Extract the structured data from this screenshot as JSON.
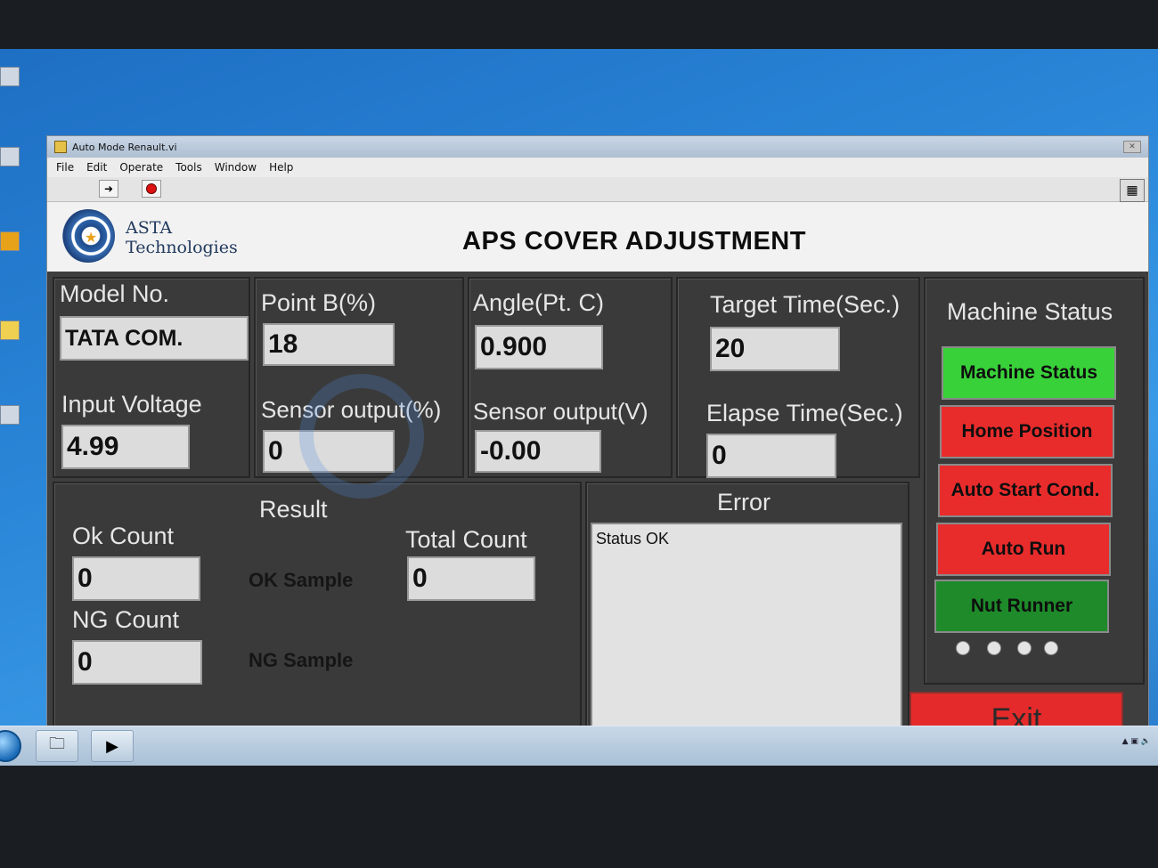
{
  "window": {
    "title": "Auto Mode Renault.vi"
  },
  "menu": [
    "File",
    "Edit",
    "Operate",
    "Tools",
    "Window",
    "Help"
  ],
  "brand": {
    "line1": "ASTA",
    "line2": "Technologies"
  },
  "page_title": "APS COVER ADJUSTMENT",
  "fields": {
    "model_no": {
      "label": "Model No.",
      "value": "TATA COM."
    },
    "input_voltage": {
      "label": "Input Voltage",
      "value": "4.99"
    },
    "point_b": {
      "label": "Point B(%)",
      "value": "18"
    },
    "sensor_output_pct": {
      "label": "Sensor output(%)",
      "value": "0"
    },
    "angle": {
      "label": "Angle(Pt. C)",
      "value": "0.900"
    },
    "sensor_output_v": {
      "label": "Sensor output(V)",
      "value": "-0.00"
    },
    "target_time": {
      "label": "Target Time(Sec.)",
      "value": "20"
    },
    "elapse_time": {
      "label": "Elapse Time(Sec.)",
      "value": "0"
    }
  },
  "result": {
    "title": "Result",
    "ok_count": {
      "label": "Ok Count",
      "value": "0"
    },
    "ng_count": {
      "label": "NG Count",
      "value": "0"
    },
    "total_count": {
      "label": "Total Count",
      "value": "0"
    },
    "ok_sample": "OK Sample",
    "ng_sample": "NG Sample"
  },
  "error": {
    "title": "Error",
    "text": "Status OK"
  },
  "machine_status": {
    "title": "Machine Status",
    "buttons": [
      {
        "label": "Machine Status",
        "color": "#39d13a"
      },
      {
        "label": "Home Position",
        "color": "#e82c2c"
      },
      {
        "label": "Auto Start Cond.",
        "color": "#e82c2c"
      },
      {
        "label": "Auto Run",
        "color": "#e82c2c"
      },
      {
        "label": "Nut Runner",
        "color": "#1e8a2a"
      }
    ]
  },
  "exit_label": "Exit",
  "colors": {
    "panel_bg": "#3e3e3e",
    "green": "#39d13a",
    "dark_green": "#1e8a2a",
    "red": "#e82c2c"
  }
}
